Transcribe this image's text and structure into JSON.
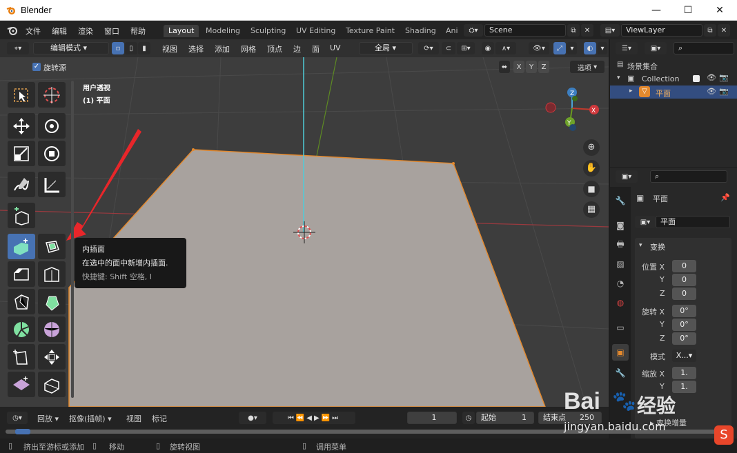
{
  "window": {
    "title": "Blender",
    "controls": [
      "—",
      "☐",
      "✕"
    ]
  },
  "menu": {
    "items": [
      "文件",
      "编辑",
      "渲染",
      "窗口",
      "帮助"
    ],
    "workspaces": [
      "Layout",
      "Modeling",
      "Sculpting",
      "UV Editing",
      "Texture Paint",
      "Shading",
      "Ani"
    ],
    "scene": "Scene",
    "view_layer": "ViewLayer"
  },
  "viewport": {
    "mode": "编辑模式",
    "menus": [
      "视图",
      "选择",
      "添加",
      "网格",
      "顶点",
      "边",
      "面",
      "UV"
    ],
    "transform_orientation": "全局",
    "options_label": "选项",
    "xyz": [
      "X",
      "Y",
      "Z"
    ],
    "rotation_pivot_label": "旋转源",
    "view_label": "用户透视",
    "object_label": "(1) 平面"
  },
  "gizmo": {
    "z": "Z",
    "x": "X",
    "y": "Y"
  },
  "tooltip": {
    "title": "内插面",
    "description": "在选中的面中新增内插面.",
    "shortcut": "快捷键: Shift 空格, I"
  },
  "timeline": {
    "playback": "回放",
    "keying": "抠像(插帧)",
    "view": "视图",
    "markers": "标记",
    "current_frame": "1",
    "start_label": "起始",
    "start": "1",
    "end_label": "结束点",
    "end": "250"
  },
  "status": {
    "items": [
      "挤出至游标或添加",
      "移动",
      "旋转视图",
      "调用菜单"
    ]
  },
  "outliner": {
    "scene_collection": "场景集合",
    "collection": "Collection",
    "object": "平面"
  },
  "properties": {
    "object_name": "平面",
    "data_name": "平面",
    "section": "变换",
    "location_label": "位置",
    "rotation_label": "旋转",
    "scale_label": "缩放",
    "mode_label": "模式",
    "mode_value": "X...",
    "location": [
      "0",
      "0",
      "0"
    ],
    "rotation": [
      "0°",
      "0°",
      "0°"
    ],
    "scale": [
      "1.",
      "1."
    ],
    "delta": "变换增量"
  },
  "watermark": {
    "brand": "Bai",
    "brand2": "经验",
    "url": "jingyan.baidu.com"
  },
  "colors": {
    "accent": "#4772b3",
    "mesh_face": "#a8a29e",
    "mesh_edge": "#e3892e",
    "arrow": "#e8262a",
    "axis_x": "#c0392b",
    "axis_y": "#6a9a1f",
    "axis_z": "#4aa3d6"
  }
}
